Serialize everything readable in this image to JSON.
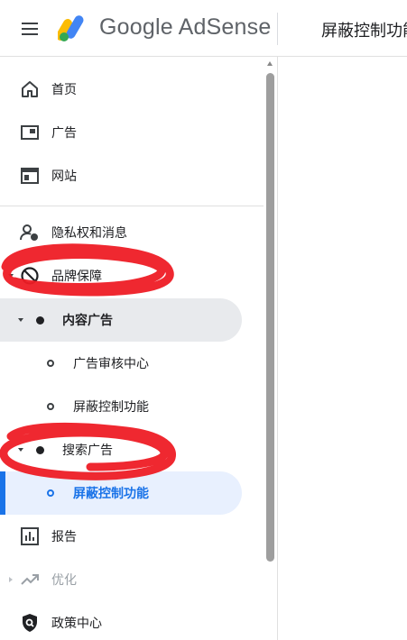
{
  "header": {
    "brand": "Google AdSense",
    "page_title": "屏蔽控制功能"
  },
  "sidebar": {
    "items": [
      {
        "label": "首页",
        "icon": "home-icon"
      },
      {
        "label": "广告",
        "icon": "ads-icon"
      },
      {
        "label": "网站",
        "icon": "sites-icon"
      },
      {
        "label": "隐私权和消息",
        "icon": "privacy-messaging-icon"
      },
      {
        "label": "品牌保障",
        "icon": "block-icon",
        "expanded": true
      },
      {
        "label": "报告",
        "icon": "reports-icon"
      },
      {
        "label": "优化",
        "icon": "trending-up-icon",
        "disabled": true
      },
      {
        "label": "政策中心",
        "icon": "policy-center-icon"
      }
    ],
    "brand_safety": {
      "content_ads": {
        "label": "内容广告",
        "children": [
          "广告审核中心",
          "屏蔽控制功能"
        ]
      },
      "search_ads": {
        "label": "搜索广告",
        "children": [
          "屏蔽控制功能"
        ]
      }
    }
  },
  "colors": {
    "accent": "#1a73e8",
    "selected_bg": "#e8f0fe",
    "group_bg": "#e8eaed",
    "annotation": "#ee1c25"
  }
}
